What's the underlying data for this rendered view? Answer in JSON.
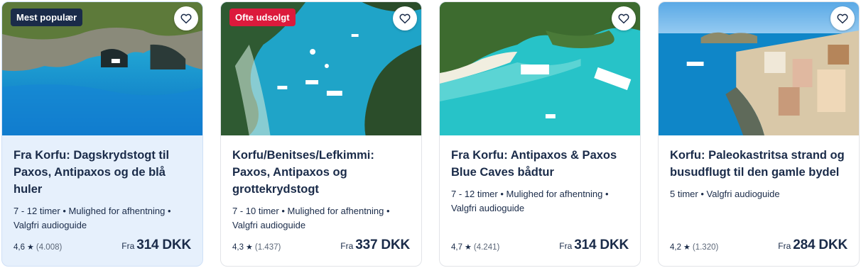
{
  "cards": [
    {
      "badge": "Mest populær",
      "badge_color": "#1a2b49",
      "title": "Fra Korfu: Dagskrydstogt til Paxos, Antipaxos og de blå huler",
      "meta": "7 - 12 timer • Mulighed for afhentning • Valgfri audioguide",
      "rating": "4,6",
      "reviews": "(4.008)",
      "price_prefix": "Fra",
      "price": "314 DKK"
    },
    {
      "badge": "Ofte udsolgt",
      "badge_color": "#dc1a3c",
      "title": "Korfu/Benitses/Lefkimmi: Paxos, Antipaxos og grottekrydstogt",
      "meta": "7 - 10 timer • Mulighed for afhentning • Valgfri audioguide",
      "rating": "4,3",
      "reviews": "(1.437)",
      "price_prefix": "Fra",
      "price": "337 DKK"
    },
    {
      "title": "Fra Korfu: Antipaxos & Paxos Blue Caves bådtur",
      "meta": "7 - 12 timer • Mulighed for afhentning • Valgfri audioguide",
      "rating": "4,7",
      "reviews": "(4.241)",
      "price_prefix": "Fra",
      "price": "314 DKK"
    },
    {
      "title": "Korfu: Paleokastritsa strand og busudflugt til den gamle bydel",
      "meta": "5 timer • Valgfri audioguide",
      "rating": "4,2",
      "reviews": "(1.320)",
      "price_prefix": "Fra",
      "price": "284 DKK"
    }
  ],
  "icons": {
    "wishlist": "heart-outline-icon",
    "rating": "star-icon"
  },
  "colors": {
    "text": "#1a2b49",
    "highlight_card_bg": "#e6f0fc"
  }
}
